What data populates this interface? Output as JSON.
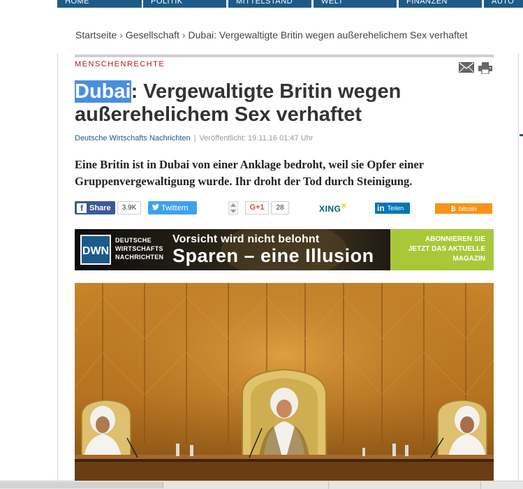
{
  "nav": {
    "items": [
      "HOME",
      "POLITIK",
      "MITTELSTAND",
      "WELT",
      "FINANZEN",
      "AUTO"
    ]
  },
  "breadcrumb": {
    "items": [
      "Startseite",
      "Gesellschaft",
      "Dubai: Vergewaltigte Britin wegen außerehelichem Sex verhaftet"
    ],
    "separator": "›"
  },
  "article": {
    "kicker": "MENSCHENRECHTE",
    "title_highlight": "Dubai",
    "title_rest": ": Vergewaltigte Britin wegen außerehelichem Sex verhaftet",
    "source": "Deutsche Wirtschafts Nachrichten",
    "byline_sep": "|",
    "published": "Veröffentlicht: 19.11.16 01:47 Uhr",
    "lead": "Eine Britin ist in Dubai von einer Anklage bedroht, weil sie Opfer einer Gruppenvergewaltigung wurde. Ihr droht der Tod durch Steinigung."
  },
  "social": {
    "facebook_label": "Share",
    "facebook_count": "3.9K",
    "twitter_label": "Twittern",
    "gplus_label": "G+1",
    "gplus_count": "28",
    "xing_label": "XING",
    "linkedin_label": "Teilen",
    "bitcoin_label": "bitcoin"
  },
  "banner": {
    "logo": "DWN",
    "brand_lines": [
      "DEUTSCHE",
      "WIRTSCHAFTS",
      "NACHRICHTEN"
    ],
    "headline_small": "Vorsicht wird nicht belohnt",
    "headline_big": "Sparen – eine Illusion",
    "cta_lines": [
      "ABONNIEREN SIE",
      "JETZT DAS AKTUELLE",
      "MAGAZIN"
    ]
  },
  "colors": {
    "nav_blue": "#1d5a8a",
    "kicker_red": "#b01818",
    "highlight": "#4a8ee0",
    "facebook": "#3b5998",
    "twitter": "#3ea1ec",
    "linkedin": "#0077b5",
    "bitcoin": "#f7931a",
    "banner_green": "#a8c83a"
  }
}
